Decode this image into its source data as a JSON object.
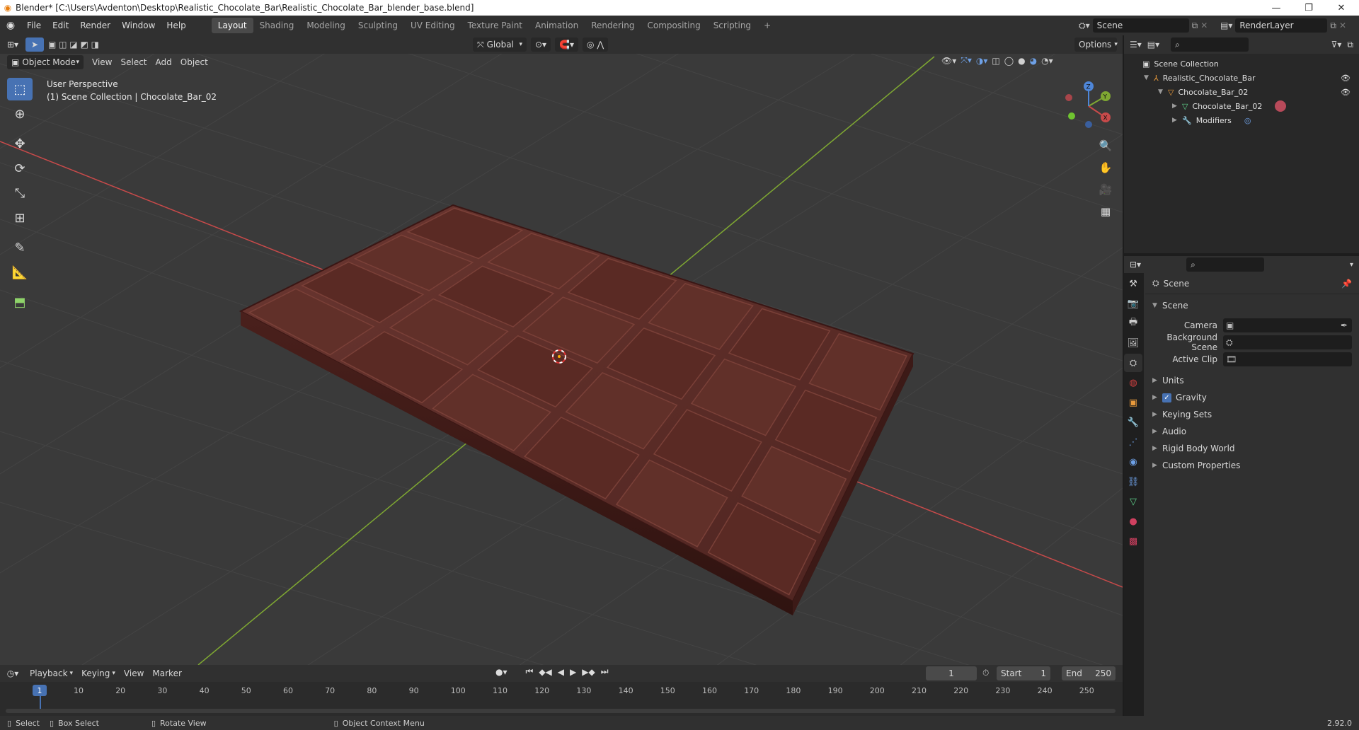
{
  "window": {
    "title": "Blender* [C:\\Users\\Avdenton\\Desktop\\Realistic_Chocolate_Bar\\Realistic_Chocolate_Bar_blender_base.blend]",
    "minimize_glyph": "—",
    "maximize_glyph": "❐",
    "close_glyph": "✕"
  },
  "menu": [
    "File",
    "Edit",
    "Render",
    "Window",
    "Help"
  ],
  "workspaces": [
    "Layout",
    "Shading",
    "Modeling",
    "Sculpting",
    "UV Editing",
    "Texture Paint",
    "Animation",
    "Rendering",
    "Compositing",
    "Scripting"
  ],
  "active_workspace": "Layout",
  "add_workspace_glyph": "+",
  "scene_field": "Scene",
  "view_layer_field": "RenderLayer",
  "viewport": {
    "mode": "Object Mode",
    "menus": [
      "View",
      "Select",
      "Add",
      "Object"
    ],
    "transform_orientation": "Global",
    "options_label": "Options",
    "overlay_line1": "User Perspective",
    "overlay_line2": "(1) Scene Collection | Chocolate_Bar_02",
    "gizmo": {
      "x": "X",
      "y": "Y",
      "z": "Z"
    }
  },
  "colors": {
    "accent": "#4772b3",
    "x_axis": "#c84a4a",
    "y_axis": "#7fa832",
    "viewport_bg": "#3a3a3a",
    "chocolate": "#5a2a24"
  },
  "timeline": {
    "menus": [
      "Playback",
      "Keying",
      "View",
      "Marker"
    ],
    "current_frame": "1",
    "start_label": "Start",
    "start_value": "1",
    "end_label": "End",
    "end_value": "250",
    "ruler": [
      "10",
      "20",
      "30",
      "40",
      "50",
      "60",
      "70",
      "80",
      "90",
      "100",
      "110",
      "120",
      "130",
      "140",
      "150",
      "160",
      "170",
      "180",
      "190",
      "200",
      "210",
      "220",
      "230",
      "240",
      "250"
    ],
    "playhead": "1"
  },
  "status": {
    "select": "Select",
    "box_select": "Box Select",
    "rotate_view": "Rotate View",
    "context_menu": "Object Context Menu",
    "version": "2.92.0"
  },
  "outliner": {
    "root": "Scene Collection",
    "items": [
      {
        "label": "Realistic_Chocolate_Bar",
        "depth": 1
      },
      {
        "label": "Chocolate_Bar_02",
        "depth": 2
      },
      {
        "label": "Chocolate_Bar_02",
        "depth": 3
      },
      {
        "label": "Modifiers",
        "depth": 3
      }
    ]
  },
  "properties": {
    "context": "Scene",
    "section": "Scene",
    "fields": [
      {
        "label": "Camera",
        "value": ""
      },
      {
        "label": "Background Scene",
        "value": ""
      },
      {
        "label": "Active Clip",
        "value": ""
      }
    ],
    "panels": [
      "Units",
      "Gravity",
      "Keying Sets",
      "Audio",
      "Rigid Body World",
      "Custom Properties"
    ]
  }
}
